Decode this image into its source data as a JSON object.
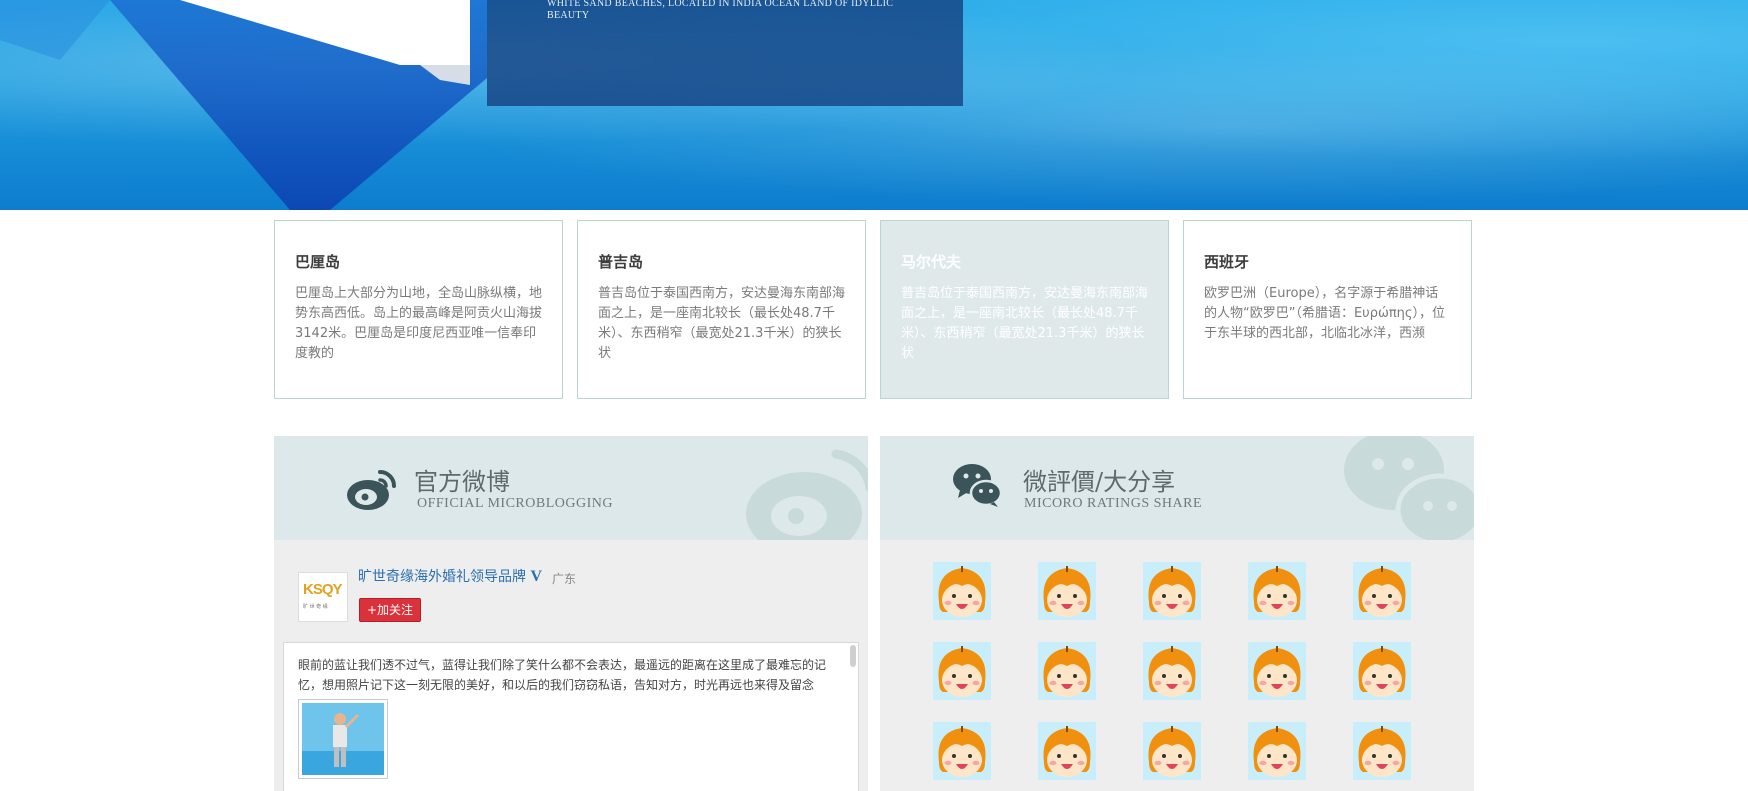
{
  "hero": {
    "subtitle": "WHITE SAND BEACHES, LOCATED IN INDIA OCEAN LAND OF IDYLLIC BEAUTY"
  },
  "cards": [
    {
      "title": "巴厘岛",
      "text": "巴厘岛上大部分为山地，全岛山脉纵横，地势东高西低。岛上的最高峰是阿贡火山海拔3142米。巴厘岛是印度尼西亚唯一信奉印度教的",
      "active": false
    },
    {
      "title": "普吉岛",
      "text": "普吉岛位于泰国西南方，安达曼海东南部海面之上，是一座南北较长（最长处48.7千米）、东西稍窄（最宽处21.3千米）的狭长状",
      "active": false
    },
    {
      "title": "马尔代夫",
      "text": "普吉岛位于泰国西南方，安达曼海东南部海面之上，是一座南北较长（最长处48.7千米）、东西稍窄（最宽处21.3千米）的狭长状",
      "active": true
    },
    {
      "title": "西班牙",
      "text": "欧罗巴洲（Europe），名字源于希腊神话的人物“欧罗巴”（希腊语：Ευρώπης），位于东半球的西北部，北临北冰洋，西濒",
      "active": false
    }
  ],
  "weibo": {
    "title": "官方微博",
    "subtitle": "OFFICIAL MICROBLOGGING",
    "brand_name": "旷世奇缘海外婚礼领导品牌",
    "verified_mark": "V",
    "region": "广东",
    "follow_label": "+加关注",
    "avatar_text": "KSQY",
    "avatar_caption": "旷 世 奇 缘",
    "post_text": "眼前的蓝让我们透不过气，蓝得让我们除了笑什么都不会表达，最遥远的距离在这里成了最难忘的记忆，想用照片记下这一刻无限的美好，和以后的我们窃窃私语，告知对方，时光再远也来得及留念 [心]"
  },
  "share": {
    "title": "微評價/大分享",
    "subtitle": "MICORO RATINGS SHARE",
    "icon": "wechat-icon",
    "faces": 15
  },
  "colors": {
    "card_border": "#b9d6d4",
    "panel_head": "#dce8e9",
    "follow": "#d9323b",
    "link": "#2a6fb0"
  }
}
